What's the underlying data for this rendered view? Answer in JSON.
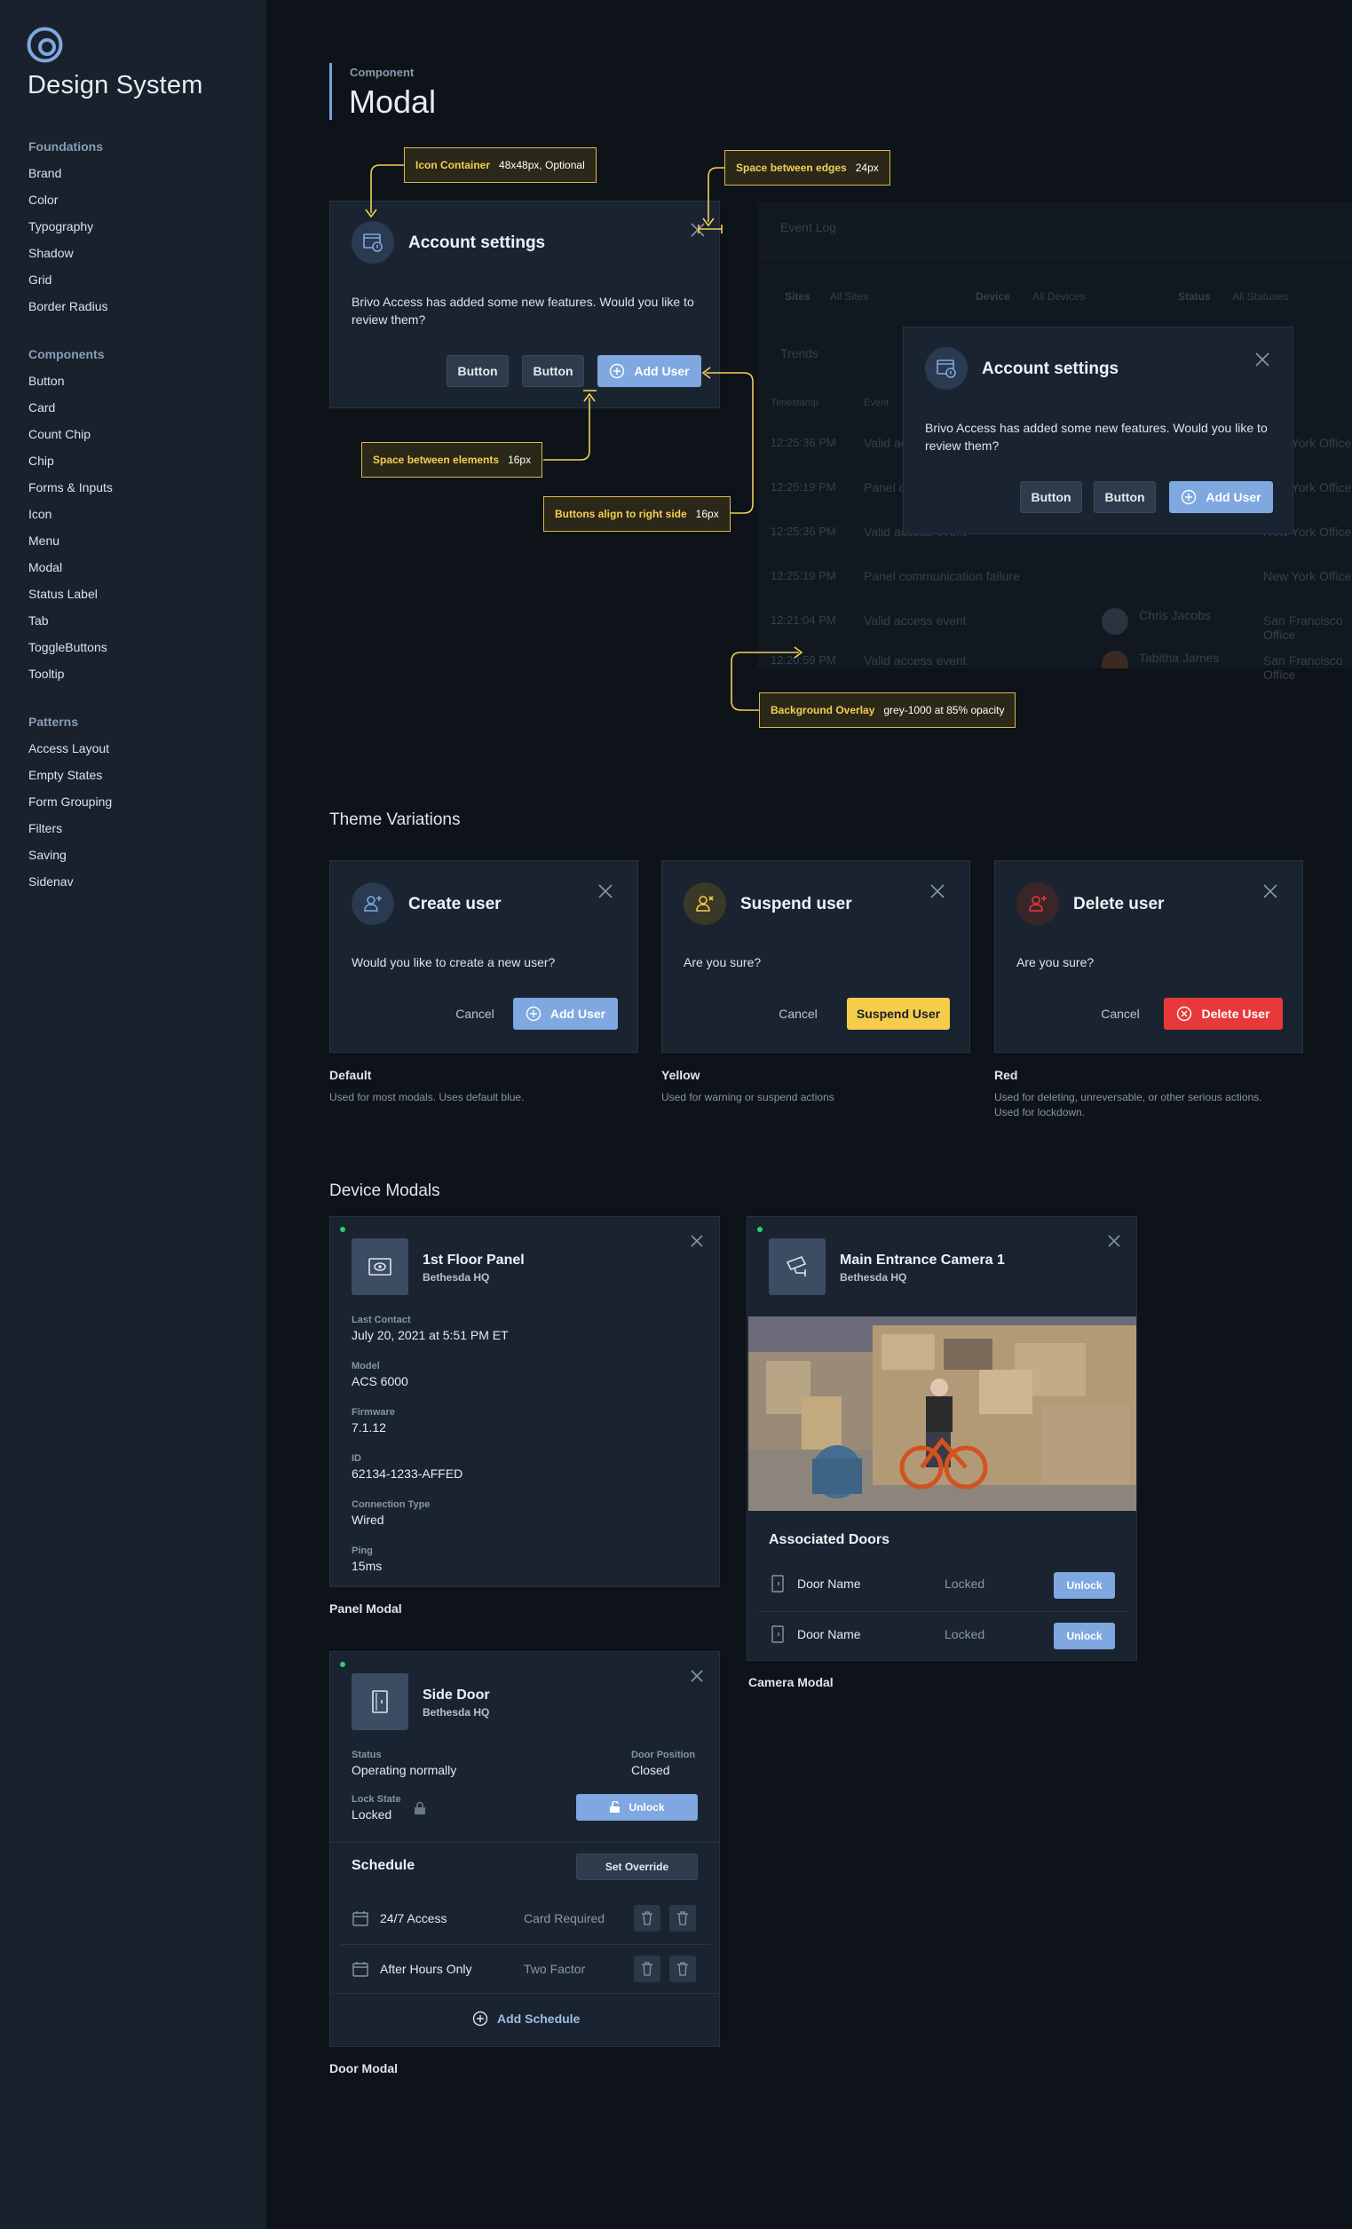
{
  "sidebar": {
    "title": "Design System",
    "foundations_heading": "Foundations",
    "foundations": [
      "Brand",
      "Color",
      "Typography",
      "Shadow",
      "Grid",
      "Border Radius"
    ],
    "components_heading": "Components",
    "components": [
      "Button",
      "Card",
      "Count Chip",
      "Chip",
      "Forms & Inputs",
      "Icon",
      "Menu",
      "Modal",
      "Status Label",
      "Tab",
      "ToggleButtons",
      "Tooltip"
    ],
    "patterns_heading": "Patterns",
    "patterns": [
      "Access Layout",
      "Empty States",
      "Form Grouping",
      "Filters",
      "Saving",
      "Sidenav"
    ]
  },
  "header": {
    "label": "Component",
    "title": "Modal"
  },
  "anatomy": {
    "modal_title": "Account settings",
    "modal_body": "Brivo Access has added some new features. Would you like to review them?",
    "button1": "Button",
    "button2": "Button",
    "primary_button": "Add User",
    "callouts": {
      "icon_container_key": "Icon Container",
      "icon_container_val": "48x48px, Optional",
      "edges_key": "Space between edges",
      "edges_val": "24px",
      "elements_key": "Space between elements",
      "elements_val": "16px",
      "align_key": "Buttons align to right side",
      "align_val": "16px",
      "overlay_key": "Background Overlay",
      "overlay_val": "grey-1000 at 85% opacity"
    }
  },
  "background_page": {
    "title": "Event Log",
    "filters": [
      "Sites",
      "All Sites",
      "Device",
      "All Devices",
      "Status",
      "All Statuses"
    ],
    "trends": "Trends",
    "col_timestamp": "Timestamp",
    "col_event": "Event",
    "rows": [
      {
        "time": "12:25:36 PM",
        "event": "Valid access event",
        "site": "New York Office"
      },
      {
        "time": "12:25:19 PM",
        "event": "Panel communication failure",
        "site": "New York Office"
      },
      {
        "time": "12:25:36 PM",
        "event": "Valid access event",
        "site": "New York Office"
      },
      {
        "time": "12:25:19 PM",
        "event": "Panel communication failure",
        "site": "New York Office"
      },
      {
        "time": "12:21:04 PM",
        "event": "Valid access event",
        "person": "Chris Jacobs",
        "site": "San Francisco Office"
      },
      {
        "time": "12:20:59 PM",
        "event": "Valid access event",
        "person": "Tabitha James",
        "site": "San Francisco Office"
      }
    ]
  },
  "theme": {
    "section_title": "Theme Variations",
    "cards": [
      {
        "title": "Create user",
        "body": "Would you like to create a new user?",
        "cancel": "Cancel",
        "action": "Add User",
        "label": "Default",
        "desc": "Used for most modals. Uses default blue.",
        "color": "#7fa7e0"
      },
      {
        "title": "Suspend user",
        "body": "Are you sure?",
        "cancel": "Cancel",
        "action": "Suspend User",
        "label": "Yellow",
        "desc": "Used for warning or suspend actions",
        "color": "#f4ce4b"
      },
      {
        "title": "Delete user",
        "body": "Are you sure?",
        "cancel": "Cancel",
        "action": "Delete User",
        "label": "Red",
        "desc": "Used for deleting, unreversable, or other serious actions. Used for lockdown.",
        "color": "#e7393b"
      }
    ]
  },
  "devices": {
    "section_title": "Device Modals",
    "panel": {
      "title": "1st Floor Panel",
      "site": "Bethesda HQ",
      "fields": [
        {
          "label": "Last Contact",
          "value": "July 20, 2021 at 5:51 PM ET"
        },
        {
          "label": "Model",
          "value": "ACS 6000"
        },
        {
          "label": "Firmware",
          "value": "7.1.12"
        },
        {
          "label": "ID",
          "value": "62134-1233-AFFED"
        },
        {
          "label": "Connection Type",
          "value": "Wired"
        },
        {
          "label": "Ping",
          "value": "15ms"
        }
      ],
      "caption": "Panel Modal"
    },
    "camera": {
      "title": "Main Entrance Camera 1",
      "site": "Bethesda HQ",
      "doors_heading": "Associated Doors",
      "doors": [
        {
          "name": "Door Name",
          "state": "Locked",
          "action": "Unlock"
        },
        {
          "name": "Door Name",
          "state": "Locked",
          "action": "Unlock"
        }
      ],
      "caption": "Camera Modal"
    },
    "door": {
      "title": "Side Door",
      "site": "Bethesda HQ",
      "status_label": "Status",
      "status_value": "Operating normally",
      "position_label": "Door Position",
      "position_value": "Closed",
      "lock_label": "Lock State",
      "lock_value": "Locked",
      "unlock": "Unlock",
      "schedule_heading": "Schedule",
      "set_override": "Set Override",
      "schedules": [
        {
          "name": "24/7 Access",
          "mode": "Card Required"
        },
        {
          "name": "After Hours Only",
          "mode": "Two Factor"
        }
      ],
      "add_schedule": "Add Schedule",
      "caption": "Door Modal"
    }
  },
  "colors": {
    "accent": "#7fa7e0",
    "warning": "#f4ce4b",
    "danger": "#e7393b",
    "callout": "#f3cf55"
  }
}
